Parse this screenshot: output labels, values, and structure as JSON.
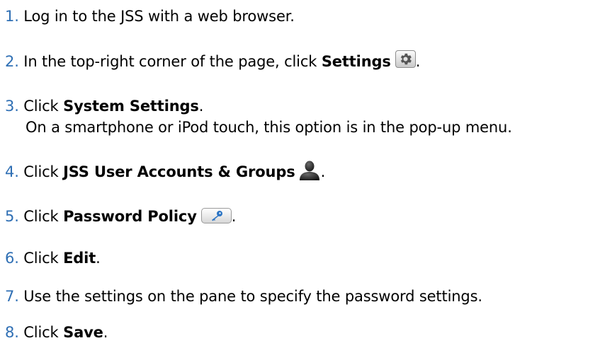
{
  "steps": [
    {
      "number": "1.",
      "text": "Log in to the JSS with a web browser."
    },
    {
      "number": "2.",
      "text": "In the top-right corner of the page, click ",
      "bold": "Settings",
      "after": ".",
      "icon": "gear-icon"
    },
    {
      "number": "3.",
      "text": "Click ",
      "bold": "System Settings",
      "after": ".",
      "note": "On a smartphone or iPod touch, this option is in the pop-up menu."
    },
    {
      "number": "4.",
      "text": "Click ",
      "bold": "JSS User Accounts & Groups",
      "after": ".",
      "icon": "user-silhouette-icon"
    },
    {
      "number": "5.",
      "text": "Click ",
      "bold": "Password Policy",
      "after": ".",
      "icon": "key-icon"
    },
    {
      "number": "6.",
      "text": "Click ",
      "bold": "Edit",
      "after": "."
    },
    {
      "number": "7.",
      "text": "Use the settings on the pane to specify the password settings."
    },
    {
      "number": "8.",
      "text": "Click ",
      "bold": "Save",
      "after": "."
    }
  ],
  "colors": {
    "step_number": "#2f6fb4",
    "text": "#000000"
  }
}
